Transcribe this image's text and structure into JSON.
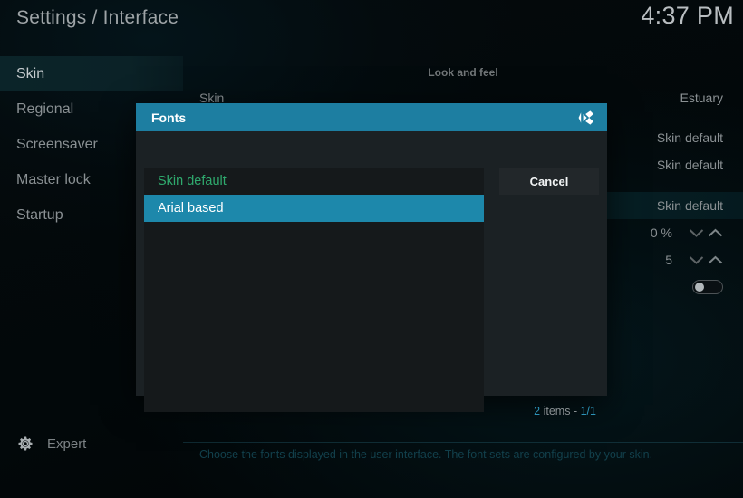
{
  "header": {
    "title": "Settings / Interface",
    "clock": "4:37 PM"
  },
  "sidebar": {
    "items": [
      {
        "label": "Skin",
        "active": true
      },
      {
        "label": "Regional",
        "active": false
      },
      {
        "label": "Screensaver",
        "active": false
      },
      {
        "label": "Master lock",
        "active": false
      },
      {
        "label": "Startup",
        "active": false
      }
    ],
    "level": {
      "icon": "gear-icon",
      "label": "Expert"
    }
  },
  "main": {
    "section_header": "Look and feel",
    "rows": [
      {
        "label": "Skin",
        "value": "Estuary",
        "control": "value",
        "highlighted": false
      },
      {
        "label": "",
        "value": "Skin default",
        "control": "value",
        "highlighted": false
      },
      {
        "label": "",
        "value": "Skin default",
        "control": "value",
        "highlighted": false
      },
      {
        "label": "",
        "value": "Skin default",
        "control": "value",
        "highlighted": true
      },
      {
        "label": "",
        "value": "0 %",
        "control": "spinner",
        "highlighted": false
      },
      {
        "label": "",
        "value": "5",
        "control": "spinner",
        "highlighted": false
      },
      {
        "label": "",
        "value": "",
        "control": "toggle",
        "toggle_on": false,
        "highlighted": false
      }
    ],
    "description": "Choose the fonts displayed in the user interface. The font sets are configured by your skin."
  },
  "dialog": {
    "title": "Fonts",
    "logo_icon": "kodi-logo-icon",
    "items": [
      {
        "label": "Skin default",
        "state": "current"
      },
      {
        "label": "Arial based",
        "state": "selected"
      }
    ],
    "cancel_label": "Cancel",
    "count": {
      "items": "2",
      "items_word": "items",
      "separator": "-",
      "page": "1/1"
    }
  },
  "colors": {
    "accent": "#1d7ea1",
    "selection": "#1d88ab",
    "current_value": "#2faa6e",
    "text_dim": "#8a9093",
    "description": "#12404c"
  }
}
